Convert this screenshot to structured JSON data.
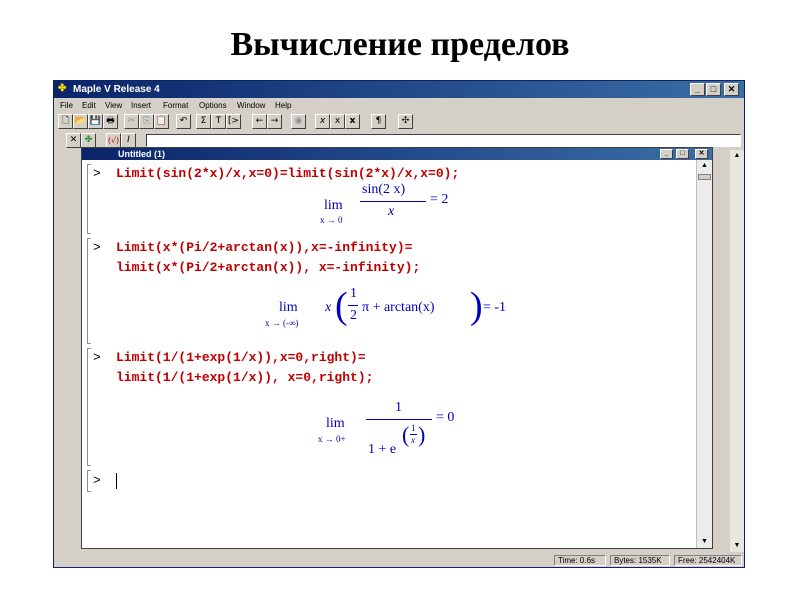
{
  "slide": {
    "title": "Вычисление пределов"
  },
  "window": {
    "title": "Maple V Release 4"
  },
  "menu": [
    "File",
    "Edit",
    "View",
    "Insert",
    "Format",
    "Options",
    "Window",
    "Help"
  ],
  "toolbar": {
    "icons": [
      "new-icon",
      "open-icon",
      "save-icon",
      "print-icon",
      "cut-icon",
      "copy-icon",
      "paste-icon",
      "undo-icon",
      "sigma-icon",
      "text-icon",
      "execute-icon",
      "back-icon",
      "forward-icon",
      "stop-icon",
      "x-italic-icon",
      "x-roman-icon",
      "x-bold-icon",
      "paragraph-icon",
      "move-icon"
    ],
    "glyphs": [
      "🗋",
      "📂",
      "💾",
      "🖶",
      "✂",
      "⎘",
      "📋",
      "↶",
      "Σ",
      "T",
      "[>",
      "←",
      "→",
      "◉",
      "x",
      "x",
      "x",
      "¶",
      "✣"
    ]
  },
  "mathbar": {
    "glyphs": [
      "✕",
      "✤",
      "(√)",
      "I"
    ]
  },
  "document": {
    "title": "Untitled (1)",
    "prompt": ">",
    "lines": [
      "Limit(sin(2*x)/x,x=0)=limit(sin(2*x)/x,x=0);",
      "Limit(x*(Pi/2+arctan(x)),x=-infinity)=",
      "limit(x*(Pi/2+arctan(x)), x=-infinity);",
      "Limit(1/(1+exp(1/x)),x=0,right)=",
      "limit(1/(1+exp(1/x)), x=0,right);"
    ],
    "out1": {
      "lim": "lim",
      "sub": "x → 0",
      "num": "sin(2 x)",
      "den": "x",
      "rhs": "= 2"
    },
    "out2": {
      "lim": "lim",
      "sub": "x → (-∞)",
      "x": "x",
      "num": "1",
      "den": "2",
      "pi": "π + arctan(x)",
      "rhs": "= -1"
    },
    "out3": {
      "lim": "lim",
      "sub": "x → 0+",
      "num": "1",
      "den": "1 + e",
      "exp_num": "1",
      "exp_den": "x",
      "rhs": "= 0"
    }
  },
  "status": {
    "time": "Time:   0.6s",
    "bytes": "Bytes:  1535K",
    "free": "Free: 2542404K"
  }
}
